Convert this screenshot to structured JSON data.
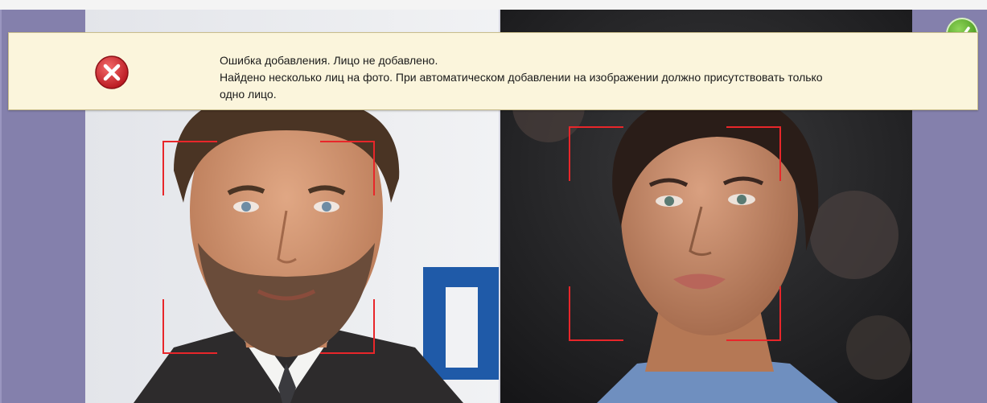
{
  "alert": {
    "icon": "error-icon",
    "title": "Ошибка добавления. Лицо не добавлено.",
    "message_line1": "Найдено несколько лиц на фото. При автоматическом добавлении на изображении должно присутствовать только",
    "message_line2": "одно лицо."
  },
  "colors": {
    "background": "#8480ac",
    "alert_background": "#fbf5dc",
    "face_frame": "#e8262a",
    "error_icon": "#c4202a",
    "accept_button": "#4b9a1f"
  },
  "photos": [
    {
      "name": "left-person-photo",
      "face_detected": true
    },
    {
      "name": "right-person-photo",
      "face_detected": true
    }
  ],
  "actions": {
    "accept_icon": "checkmark-icon"
  }
}
